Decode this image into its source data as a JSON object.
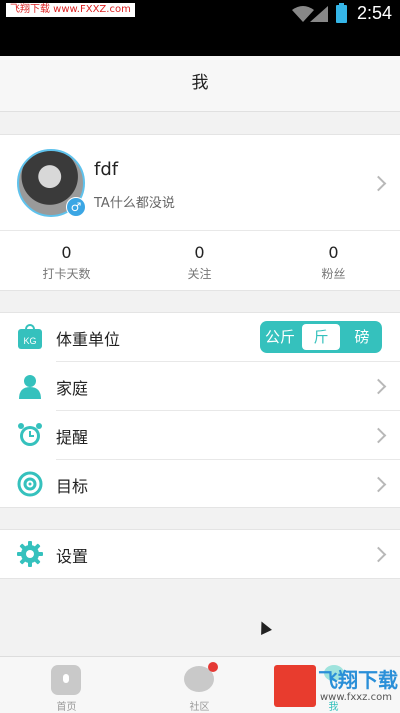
{
  "status_bar": {
    "watermark_label": "飞翔下载 www.FXXZ.com",
    "time": "2:54"
  },
  "header": {
    "title": "我"
  },
  "profile": {
    "name": "fdf",
    "signature": "TA什么都没说",
    "gender_icon": "male-icon",
    "stats": [
      {
        "value": "0",
        "label": "打卡天数"
      },
      {
        "value": "0",
        "label": "关注"
      },
      {
        "value": "0",
        "label": "粉丝"
      }
    ]
  },
  "menu": {
    "weight_unit": {
      "label": "体重单位",
      "options": [
        "公斤",
        "斤",
        "磅"
      ],
      "selected": "斤"
    },
    "items": [
      {
        "label": "家庭",
        "icon": "person-icon"
      },
      {
        "label": "提醒",
        "icon": "alarm-clock-icon"
      },
      {
        "label": "目标",
        "icon": "target-icon"
      }
    ],
    "settings": {
      "label": "设置",
      "icon": "gear-icon"
    }
  },
  "tabbar": {
    "tabs": [
      {
        "label": "首页",
        "icon": "home-icon"
      },
      {
        "label": "社区",
        "icon": "chat-bubble-icon",
        "badge": true
      },
      {
        "label": "我",
        "icon": "me-icon"
      }
    ]
  },
  "watermark": {
    "brand": "飞翔下载",
    "url": "www.fxxz.com"
  },
  "colors": {
    "accent": "#35c1bd",
    "avatar_ring": "#5fc2ec",
    "badge": "#e53935"
  }
}
